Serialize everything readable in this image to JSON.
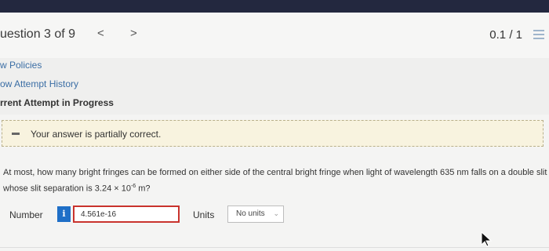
{
  "header": {
    "question_label": "uestion 3 of 9",
    "prev_icon": "chevron-left-icon",
    "next_icon": "chevron-right-icon",
    "prev_glyph": "<",
    "next_glyph": ">",
    "score": "0.1 / 1",
    "menu_icon": "menu-icon"
  },
  "links": {
    "policies": "w Policies",
    "attempt_history": "ow Attempt History",
    "current_attempt": "rrent Attempt in Progress"
  },
  "feedback": {
    "text": "Your answer is partially correct.",
    "status_color": "#f8f3df"
  },
  "question": {
    "text_part1": "At most, how many bright fringes can be formed on either side of the central bright fringe when light of wavelength 635 nm falls on a double slit whose slit separation is 3.24 × 10",
    "exponent": "-6",
    "text_part2": " m?"
  },
  "answer": {
    "label": "Number",
    "info_glyph": "i",
    "value": "4.561e-16",
    "units_label": "Units",
    "units_value": "No units",
    "input_border_color": "#c9332d"
  },
  "colors": {
    "top_bar": "#23283f",
    "link": "#3b6ea5",
    "info_button": "#1f6fc7"
  }
}
